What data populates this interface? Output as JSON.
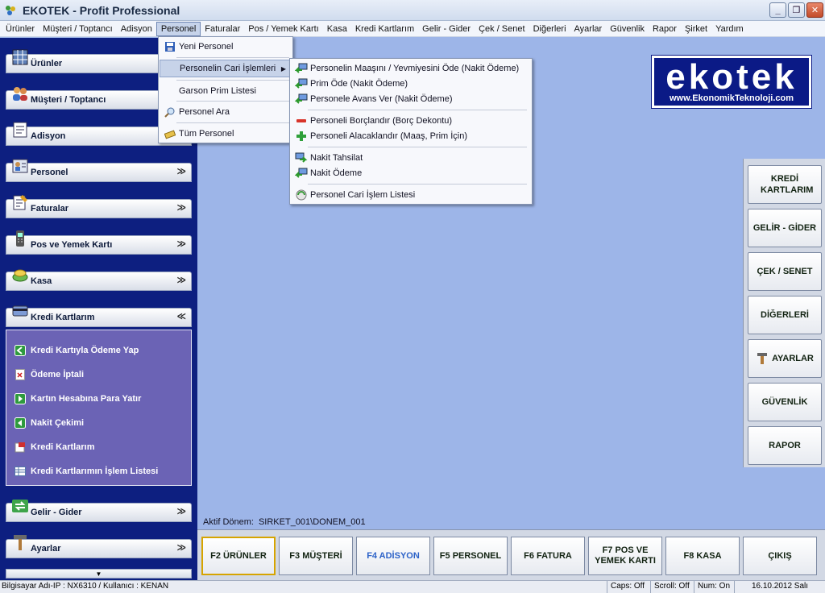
{
  "window": {
    "title": "EKOTEK - Profit Professional"
  },
  "menubar": [
    "Ürünler",
    "Müşteri / Toptancı",
    "Adisyon",
    "Personel",
    "Faturalar",
    "Pos / Yemek Kartı",
    "Kasa",
    "Kredi Kartlarım",
    "Gelir - Gider",
    "Çek / Senet",
    "Diğerleri",
    "Ayarlar",
    "Güvenlik",
    "Rapor",
    "Şirket",
    "Yardım"
  ],
  "sidebar": {
    "sections": [
      {
        "label": "Ürünler",
        "icon": "grid-icon",
        "chevron": ""
      },
      {
        "label": "Müşteri / Toptancı",
        "icon": "people-icon",
        "chevron": ""
      },
      {
        "label": "Adisyon",
        "icon": "receipt-icon",
        "chevron": ""
      },
      {
        "label": "Personel",
        "icon": "id-card-icon",
        "chevron": "»"
      },
      {
        "label": "Faturalar",
        "icon": "invoice-icon",
        "chevron": "»"
      },
      {
        "label": "Pos ve Yemek Kartı",
        "icon": "pos-terminal-icon",
        "chevron": "»"
      },
      {
        "label": "Kasa",
        "icon": "cash-icon",
        "chevron": "»"
      },
      {
        "label": "Kredi Kartlarım",
        "icon": "credit-card-icon",
        "chevron": "«"
      },
      {
        "label": "Gelir - Gider",
        "icon": "exchange-icon",
        "chevron": "»"
      },
      {
        "label": "Ayarlar",
        "icon": "hammer-icon",
        "chevron": "»"
      }
    ],
    "kredi_items": [
      "Kredi Kartıyla Ödeme Yap",
      "Ödeme İptali",
      "Kartın Hesabına Para Yatır",
      "Nakit Çekimi",
      "Kredi Kartlarım",
      "Kredi Kartlarımın İşlem Listesi"
    ]
  },
  "personel_menu": [
    "Yeni Personel",
    "Personelin Cari İşlemleri",
    "Garson Prim Listesi",
    "Personel Ara",
    "Tüm Personel"
  ],
  "cari_menu": [
    "Personelin Maaşını / Yevmiyesini Öde (Nakit Ödeme)",
    "Prim Öde (Nakit Ödeme)",
    "Personele Avans Ver (Nakit Ödeme)",
    "Personeli Borçlandır (Borç Dekontu)",
    "Personeli Alacaklandır (Maaş, Prim İçin)",
    "Nakit Tahsilat",
    "Nakit Ödeme",
    "Personel Cari İşlem Listesi"
  ],
  "logo": {
    "main": "ekotek",
    "sub": "www.EkonomikTeknoloji.com"
  },
  "aktif_donem": {
    "label": "Aktif Dönem:",
    "value": "SIRKET_001\\DONEM_001"
  },
  "right_buttons": [
    "KREDİ KARTLARIM",
    "GELİR - GİDER",
    "ÇEK / SENET",
    "DİĞERLERİ",
    "AYARLAR",
    "GÜVENLİK",
    "RAPOR"
  ],
  "fkeys": [
    "F2 ÜRÜNLER",
    "F3 MÜŞTERİ",
    "F4 ADİSYON",
    "F5 PERSONEL",
    "F6 FATURA",
    "F7 POS VE YEMEK KARTI",
    "F8 KASA",
    "ÇIKIŞ"
  ],
  "status": {
    "left": "Bilgisayar Adı-IP : NX6310 / Kullanıcı : KENAN",
    "caps": "Caps: Off",
    "scroll": "Scroll: Off",
    "num": "Num: On",
    "date": "16.10.2012 Salı"
  }
}
